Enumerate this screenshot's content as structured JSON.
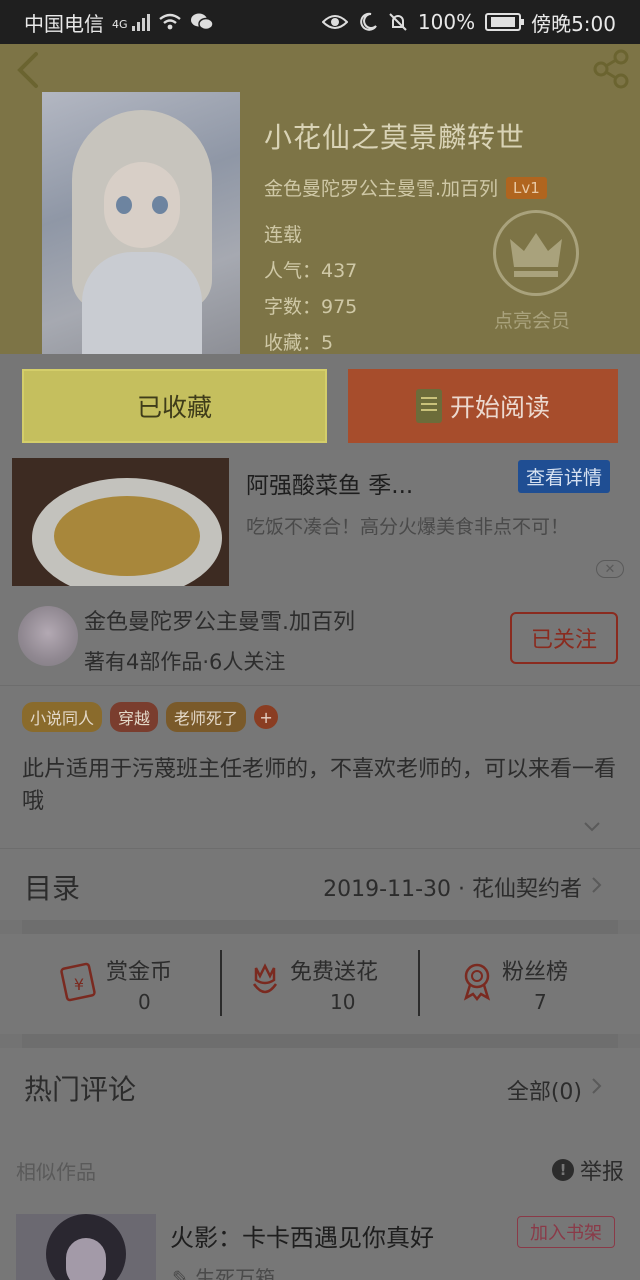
{
  "status_bar": {
    "carrier": "中国电信",
    "network": "4G",
    "battery": "100%",
    "time": "傍晚5:00"
  },
  "book": {
    "title": "小花仙之莫景麟转世",
    "author": "金色曼陀罗公主曼雪.加百列",
    "level": "Lv1",
    "status": "连载",
    "popularity": "人气：437",
    "word_count": "字数：975",
    "favorites": "收藏：5",
    "vip_label": "点亮会员"
  },
  "actions": {
    "collected_label": "已收藏",
    "read_label": "开始阅读"
  },
  "ad": {
    "title": "阿强酸菜鱼 季...",
    "detail_label": "查看详情",
    "description": "吃饭不凑合！高分火爆美食非点不可！",
    "close_label": "✕"
  },
  "author_card": {
    "name": "金色曼陀罗公主曼雪.加百列",
    "stats": "著有4部作品·6人关注",
    "follow_label": "已关注"
  },
  "tags": [
    {
      "label": "小说同人",
      "color": "#8a6b2c"
    },
    {
      "label": "穿越",
      "color": "#7a3d2e"
    },
    {
      "label": "老师死了",
      "color": "#7a5a2a"
    }
  ],
  "tag_add_label": "+",
  "description": "此片适用于污蔑班主任老师的，不喜欢老师的，可以来看一看哦",
  "catalog": {
    "title": "目录",
    "update": "2019-11-30 · 花仙契约者"
  },
  "stats": [
    {
      "label": "赏金币",
      "value": "0",
      "icon": "red-packet-icon"
    },
    {
      "label": "免费送花",
      "value": "10",
      "icon": "flower-icon"
    },
    {
      "label": "粉丝榜",
      "value": "7",
      "icon": "medal-icon"
    }
  ],
  "comments": {
    "title": "热门评论",
    "all_label": "全部(0)"
  },
  "similar": {
    "title": "相似作品",
    "report_label": "举报",
    "items": [
      {
        "title": "火影：卡卡西遇见你真好",
        "author": "生死万箱",
        "add_label": "加入书架"
      }
    ]
  }
}
